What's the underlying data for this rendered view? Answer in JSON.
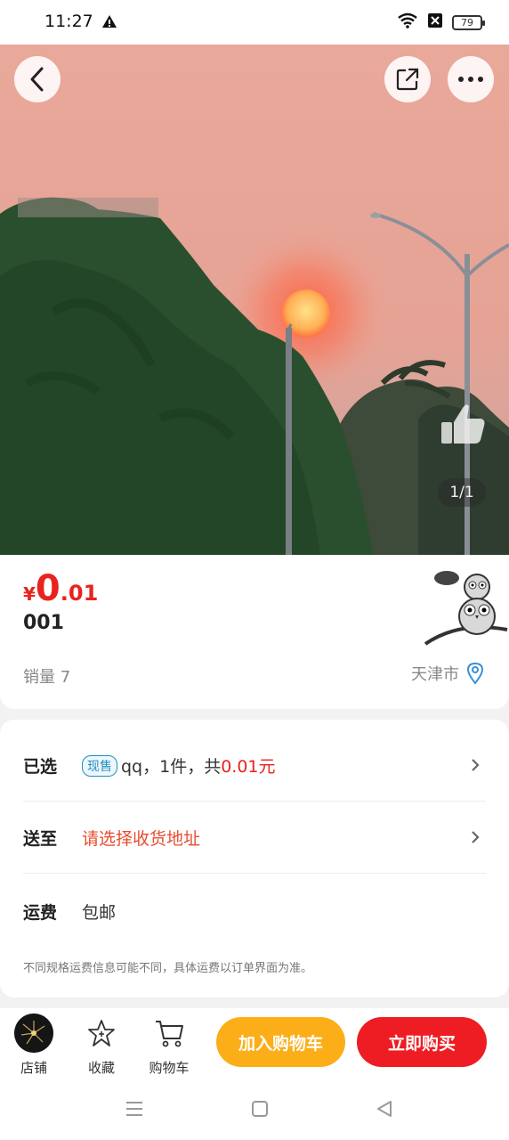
{
  "status_bar": {
    "time": "11:27",
    "battery": "79"
  },
  "hero": {
    "pager": "1/1"
  },
  "product": {
    "currency_symbol": "¥",
    "price_int": "0",
    "price_dec": ".01",
    "name": "001",
    "sales_label": "销量 7",
    "location": "天津市"
  },
  "options": {
    "selected": {
      "label": "已选",
      "tag": "现售",
      "value_prefix": "qq，1件，共",
      "total": "0.01元"
    },
    "ship_to": {
      "label": "送至",
      "value": "请选择收货地址"
    },
    "freight": {
      "label": "运费",
      "value": "包邮"
    },
    "note": "不同规格运费信息可能不同，具体运费以订单界面为准。"
  },
  "bottom_bar": {
    "store_label": "店铺",
    "favorite_label": "收藏",
    "cart_label": "购物车",
    "add_to_cart": "加入购物车",
    "buy_now": "立即购买"
  },
  "colors": {
    "price_red": "#e8231e",
    "cart_orange": "#fbae17",
    "buy_red": "#ee1d23",
    "tag_blue": "#1f8fbf"
  }
}
